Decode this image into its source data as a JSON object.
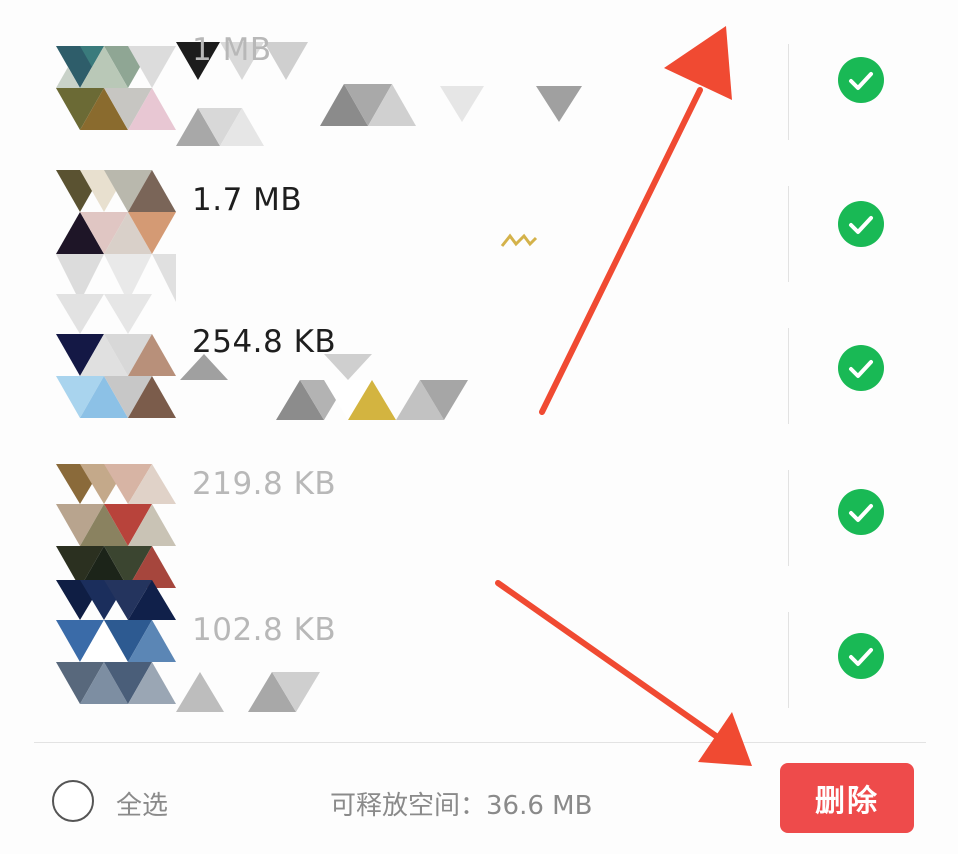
{
  "files": [
    {
      "size": "1 MB",
      "selected": true
    },
    {
      "size": "1.7 MB",
      "selected": true
    },
    {
      "size": "254.8 KB",
      "selected": true
    },
    {
      "size": "219.8 KB",
      "selected": true
    },
    {
      "size": "102.8 KB",
      "selected": true
    }
  ],
  "footer": {
    "select_all_label": "全选",
    "free_space_text": "可释放空间：36.6 MB",
    "delete_label": "删除"
  },
  "colors": {
    "check_green": "#19b955",
    "delete_red": "#ee4b4b",
    "annotation_arrow": "#f04a32"
  },
  "icons": {
    "check": "check-circle-icon",
    "radio": "radio-unchecked-icon",
    "annotation": "red-arrow-annotation"
  }
}
